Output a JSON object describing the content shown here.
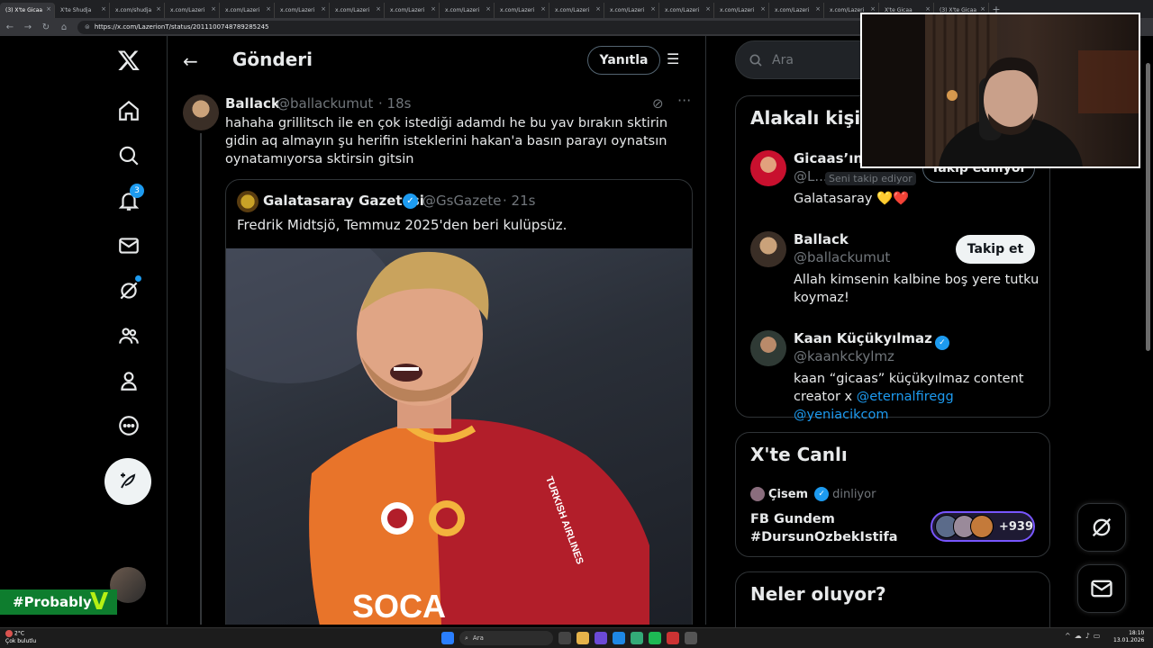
{
  "browser": {
    "tabs": [
      {
        "label": "(3) X'te Gicaa",
        "active": true
      },
      {
        "label": "X'te Shudja"
      },
      {
        "label": "x.com/shudja"
      },
      {
        "label": "x.com/Lazeri"
      },
      {
        "label": "x.com/Lazeri"
      },
      {
        "label": "x.com/Lazeri"
      },
      {
        "label": "x.com/Lazeri"
      },
      {
        "label": "x.com/Lazeri"
      },
      {
        "label": "x.com/Lazeri"
      },
      {
        "label": "x.com/Lazeri"
      },
      {
        "label": "x.com/Lazeri"
      },
      {
        "label": "x.com/Lazeri"
      },
      {
        "label": "x.com/Lazeri"
      },
      {
        "label": "x.com/Lazeri"
      },
      {
        "label": "x.com/Lazeri"
      },
      {
        "label": "x.com/Lazeri"
      },
      {
        "label": "X'te Gicaa"
      },
      {
        "label": "(3) X'te Gicaa"
      }
    ],
    "url": "https://x.com/LazerionT/status/2011100748789285245"
  },
  "nav": {
    "notifications_badge": "3",
    "brand_badge": "#Probably"
  },
  "header": {
    "title": "Gönderi",
    "reply_button": "Yanıtla"
  },
  "reply": {
    "name": "Ballack",
    "handle": "@ballackumut",
    "time": "· 18s",
    "text": "hahaha grillitsch ile en çok istediği adamdı he bu yav bırakın sktirin gidin aq almayın şu herifin isteklerini hakan'a basın parayı oynatsın oynatamıyorsa sktirsin gitsin"
  },
  "quote": {
    "name": "Galatasaray Gazetesi",
    "handle": "@GsGazete",
    "time": "· 21s",
    "text": "Fredrik Midtsjö, Temmuz 2025'den beri kulüpsüz.",
    "photo_jersey_text": "SOCA",
    "photo_sponsor": "TURKISH AIRLINES"
  },
  "search": {
    "placeholder": "Ara"
  },
  "related": {
    "title": "Alakalı kişiler",
    "people": [
      {
        "name": "Gicaas’ın e",
        "handle": "@L...",
        "follows_you": "Seni takip ediyor",
        "button": "Takip ediliyor",
        "bio": "Galatasaray 💛❤️"
      },
      {
        "name": "Ballack",
        "handle": "@ballackumut",
        "button": "Takip et",
        "bio": "Allah kimsenin kalbine boş yere tutku koymaz!"
      },
      {
        "name": "Kaan Küçükyılmaz",
        "handle": "@kaankckylmz",
        "bio_prefix": "kaan “gicaas” küçükyılmaz content creator x ",
        "bio_link1": "@eternalfiregg",
        "bio_link2": "@yeniacikcom"
      }
    ]
  },
  "live": {
    "title": "X'te Canlı",
    "host": "Çisem",
    "host_state": "dinliyor",
    "space_title": "FB Gundem #DursunOzbekIstifa",
    "listener_count": "+939"
  },
  "trends": {
    "title": "Neler oluyor?"
  },
  "taskbar": {
    "weather_temp": "2°C",
    "weather_desc": "Çok bulutlu",
    "search_placeholder": "Ara",
    "time": "18:10",
    "date": "13.01.2026"
  },
  "colors": {
    "accent": "#1d9bf0",
    "background": "#000000",
    "border": "#2f3336",
    "muted_text": "#71767b",
    "live_border": "#7856ff"
  }
}
